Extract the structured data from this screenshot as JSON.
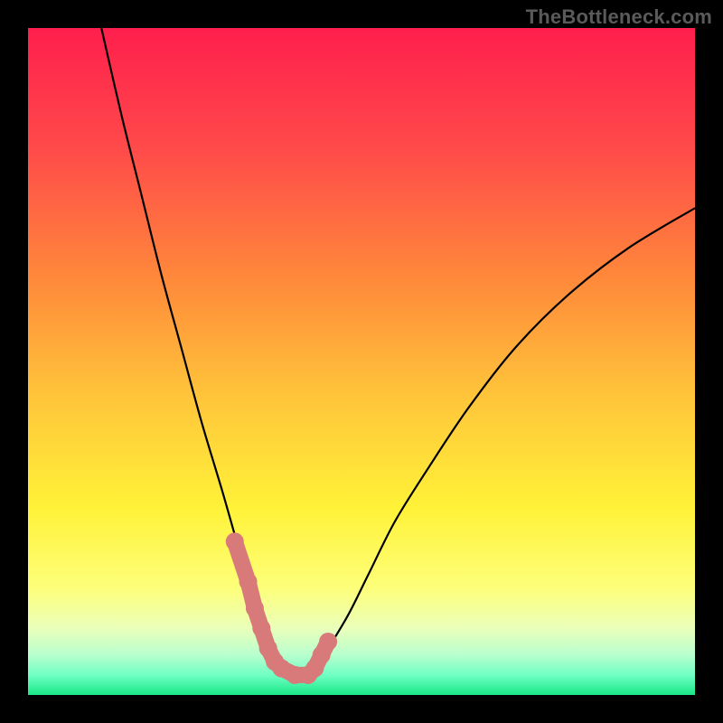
{
  "meta": {
    "watermark": "TheBottleneck.com"
  },
  "chart_data": {
    "type": "line",
    "title": "",
    "xlabel": "",
    "ylabel": "",
    "xlim": [
      0,
      100
    ],
    "ylim": [
      0,
      100
    ],
    "grid": false,
    "legend": false,
    "series": [
      {
        "name": "curve",
        "x": [
          11,
          14,
          17,
          20,
          23,
          26,
          29,
          31,
          33,
          35,
          37,
          38,
          42,
          43,
          45,
          48,
          51,
          55,
          60,
          66,
          73,
          81,
          90,
          100
        ],
        "y": [
          100,
          87,
          75,
          63,
          52,
          41,
          31,
          24,
          17,
          11,
          6,
          3,
          3,
          4,
          7,
          12,
          18,
          26,
          34,
          43,
          52,
          60,
          67,
          73
        ]
      },
      {
        "name": "highlight-points",
        "x": [
          31,
          33,
          34,
          35,
          36,
          37,
          38,
          40,
          42,
          43,
          44,
          45
        ],
        "y": [
          23,
          17,
          13,
          10,
          7,
          5,
          4,
          3,
          3,
          4,
          6,
          8
        ]
      }
    ],
    "background_gradient_stops": [
      {
        "offset": 0.0,
        "color": "#ff1f4d"
      },
      {
        "offset": 0.18,
        "color": "#ff4a4a"
      },
      {
        "offset": 0.38,
        "color": "#ff8a3a"
      },
      {
        "offset": 0.55,
        "color": "#ffc43a"
      },
      {
        "offset": 0.72,
        "color": "#fff238"
      },
      {
        "offset": 0.84,
        "color": "#fdff7a"
      },
      {
        "offset": 0.9,
        "color": "#eaffba"
      },
      {
        "offset": 0.94,
        "color": "#b8ffce"
      },
      {
        "offset": 0.97,
        "color": "#70ffc4"
      },
      {
        "offset": 1.0,
        "color": "#18e886"
      }
    ],
    "highlight_color": "#d87a7a",
    "curve_color": "#000000"
  }
}
